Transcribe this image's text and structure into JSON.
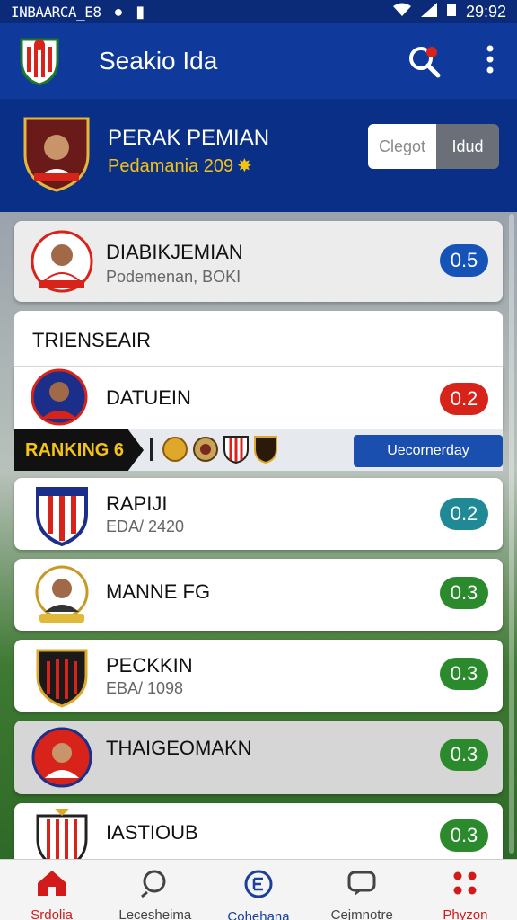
{
  "status_bar": {
    "carrier": "INBAARCA_E8",
    "time": "29:92"
  },
  "app_bar": {
    "title": "Seakio Ida"
  },
  "profile": {
    "name": "PERAK PEMIAN",
    "subtitle": "Pedamania 209"
  },
  "segment": {
    "option_a": "Clegot",
    "option_b": "Idud"
  },
  "top_card": {
    "name": "DIABIKJEMIAN",
    "subtitle": "Podemenan, BOKI",
    "score": "0.5"
  },
  "section": {
    "title": "TRIENSEAIR"
  },
  "players": [
    {
      "name": "DATUEIN",
      "subtitle": "",
      "score": "0.2"
    },
    {
      "name": "RAPIJI",
      "subtitle": "EDA/ 2420",
      "score": "0.2"
    },
    {
      "name": "MANNE FG",
      "subtitle": "",
      "score": "0.3"
    },
    {
      "name": "PECKKIN",
      "subtitle": "EBA/ 1098",
      "score": "0.3"
    },
    {
      "name": "THAIGEOMAKN",
      "subtitle": "",
      "score": "0.3"
    },
    {
      "name": "IASTIOUB",
      "subtitle": "",
      "score": "0.3"
    }
  ],
  "ranking": {
    "label": "RANKING 6",
    "button": "Uecornerday"
  },
  "bottom_nav": [
    {
      "label": "Srdolia"
    },
    {
      "label": "Lecesheima"
    },
    {
      "label": "Cohehana"
    },
    {
      "label": "Cejmnotre"
    },
    {
      "label": "Phyzon"
    }
  ],
  "colors": {
    "primary": "#0f3a9c",
    "accent_gold": "#f2c316",
    "score_blue": "#1553b8",
    "score_red": "#d8231b",
    "score_teal": "#1f8a96",
    "score_green": "#2a8a2c",
    "nav_active": "#d21a1a"
  }
}
